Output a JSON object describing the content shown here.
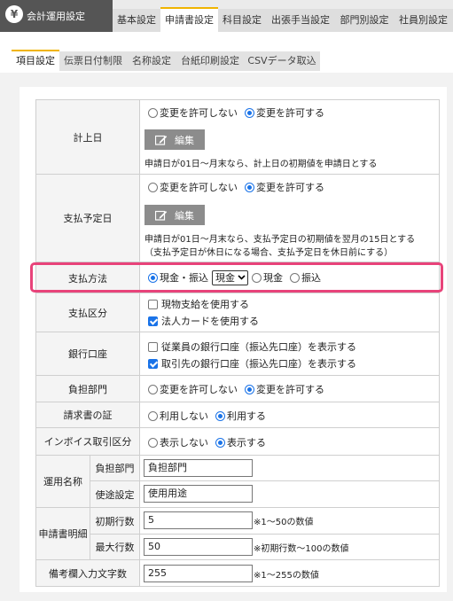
{
  "app": {
    "title": "会計運用設定",
    "icon": "yen-icon"
  },
  "tabs": [
    "基本設定",
    "申請書設定",
    "科目設定",
    "出張手当設定",
    "部門別設定",
    "社員別設定"
  ],
  "subtabs": [
    "項目設定",
    "伝票日付制限",
    "名称設定",
    "台紙印刷設定",
    "CSVデータ取込"
  ],
  "options": {
    "deny_change": "変更を許可しない",
    "allow_change": "変更を許可する",
    "edit": "編集"
  },
  "rows": {
    "keijobi": {
      "label": "計上日",
      "note": "申請日が01日～月末なら、計上日の初期値を申請日とする"
    },
    "shiharai_yoteibi": {
      "label": "支払予定日",
      "note1": "申請日が01日～月末なら、支払予定日の初期値を翌月の15日とする",
      "note2": "（支払予定日が休日になる場合、支払予定日を休日前にする）"
    },
    "shiharai_houhou": {
      "label": "支払方法",
      "opt1": "現金・振込",
      "select_value": "現金",
      "opt2": "現金",
      "opt3": "振込"
    },
    "shiharai_kubun": {
      "label": "支払区分",
      "check1": "現物支給を使用する",
      "check2": "法人カードを使用する"
    },
    "ginko_koza": {
      "label": "銀行口座",
      "check1": "従業員の銀行口座（振込先口座）を表示する",
      "check2": "取引先の銀行口座（振込先口座）を表示する"
    },
    "futan_bumon": {
      "label": "負担部門"
    },
    "seikyusho": {
      "label": "請求書の証",
      "opt1": "利用しない",
      "opt2": "利用する"
    },
    "invoice": {
      "label": "インボイス取引区分",
      "opt1": "表示しない",
      "opt2": "表示する"
    },
    "unyo_meisho": {
      "label": "運用名称",
      "sub1_label": "負担部門",
      "sub1_value": "負担部門",
      "sub2_label": "使途設定",
      "sub2_value": "使用用途"
    },
    "shinseisho_meisai": {
      "label": "申請書明細",
      "sub1_label": "初期行数",
      "sub1_value": "5",
      "sub1_hint": "※1～50の数値",
      "sub2_label": "最大行数",
      "sub2_value": "50",
      "sub2_hint": "※初期行数～100の数値"
    },
    "bikoran": {
      "label": "備考欄入力文字数",
      "value": "255",
      "hint": "※1～255の数値"
    }
  },
  "colors": {
    "highlight": "#e8437a",
    "accent_tab": "#f0b400",
    "radio_on": "#1a73e8"
  }
}
